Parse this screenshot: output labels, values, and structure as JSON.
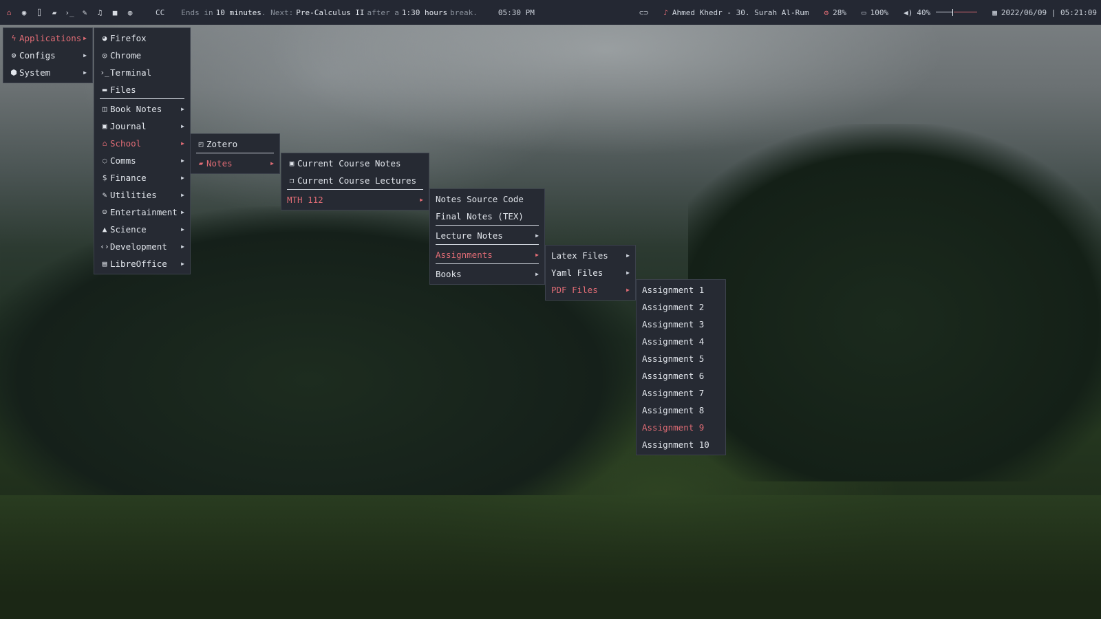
{
  "topbar": {
    "workspace_icons": [
      "home-icon",
      "globe-icon",
      "bank-icon",
      "folder-icon",
      "terminal-icon",
      "edit-icon",
      "music-icon",
      "video-icon",
      "chat-icon"
    ],
    "cc": "CC",
    "ends_in_label": "Ends in",
    "ends_in_value": "10 minutes",
    "next_label": ". Next:",
    "next_course": "Pre-Calculus II",
    "after_label": "after a",
    "break_duration": "1:30 hours",
    "break_label": "break.",
    "class_time": "05:30 PM",
    "now_playing": "Ahmed Khedr - 30. Surah Al-Rum",
    "cpu": "28%",
    "battery": "100%",
    "volume": "40%",
    "volume_level": 0.4,
    "datetime": "2022/06/09 | 05:21:09"
  },
  "menus": {
    "root": [
      {
        "label": "Applications",
        "icon": "bolt-icon",
        "glyph": "ϟ",
        "submenu": true,
        "active": true
      },
      {
        "label": "Configs",
        "icon": "gears-icon",
        "glyph": "⚙",
        "submenu": true
      },
      {
        "label": "System",
        "icon": "cube-icon",
        "glyph": "⬢",
        "submenu": true
      }
    ],
    "applications": [
      {
        "label": "Firefox",
        "icon": "firefox-icon",
        "glyph": "◕"
      },
      {
        "label": "Chrome",
        "icon": "chrome-icon",
        "glyph": "◎"
      },
      {
        "label": "Terminal",
        "icon": "terminal-icon",
        "glyph": "›_"
      },
      {
        "label": "Files",
        "icon": "folder-icon",
        "glyph": "▬",
        "separator_after": true
      },
      {
        "label": "Book Notes",
        "icon": "book-icon",
        "glyph": "◫",
        "submenu": true
      },
      {
        "label": "Journal",
        "icon": "journal-icon",
        "glyph": "▣",
        "submenu": true
      },
      {
        "label": "School",
        "icon": "school-icon",
        "glyph": "⌂",
        "submenu": true,
        "active": true
      },
      {
        "label": "Comms",
        "icon": "comment-icon",
        "glyph": "◌",
        "submenu": true
      },
      {
        "label": "Finance",
        "icon": "dollar-icon",
        "glyph": "$",
        "submenu": true
      },
      {
        "label": "Utilities",
        "icon": "wrench-icon",
        "glyph": "✎",
        "submenu": true
      },
      {
        "label": "Entertainment",
        "icon": "smile-icon",
        "glyph": "☺",
        "submenu": true
      },
      {
        "label": "Science",
        "icon": "flask-icon",
        "glyph": "▲",
        "submenu": true
      },
      {
        "label": "Development",
        "icon": "code-icon",
        "glyph": "‹›",
        "submenu": true
      },
      {
        "label": "LibreOffice",
        "icon": "document-icon",
        "glyph": "▤",
        "submenu": true
      }
    ],
    "school": [
      {
        "label": "Zotero",
        "icon": "zotero-icon",
        "glyph": "◰",
        "separator_after": true
      },
      {
        "label": "Notes",
        "icon": "notes-icon",
        "glyph": "▰",
        "submenu": true,
        "active": true
      }
    ],
    "notes": [
      {
        "label": "Current Course Notes",
        "icon": "image-file-icon",
        "glyph": "▣"
      },
      {
        "label": "Current Course Lectures",
        "icon": "copy-icon",
        "glyph": "❐",
        "separator_after": true
      },
      {
        "label": "MTH 112",
        "submenu": true,
        "active": true
      }
    ],
    "mth112": [
      {
        "label": "Notes Source Code"
      },
      {
        "label": "Final Notes (TEX)",
        "separator_after": true
      },
      {
        "label": "Lecture Notes",
        "submenu": true,
        "separator_after": true
      },
      {
        "label": "Assignments",
        "submenu": true,
        "active": true,
        "separator_after": true
      },
      {
        "label": "Books",
        "submenu": true
      }
    ],
    "assignments": [
      {
        "label": "Latex Files",
        "submenu": true
      },
      {
        "label": "Yaml Files",
        "submenu": true
      },
      {
        "label": "PDF Files",
        "submenu": true,
        "active": true
      }
    ],
    "pdf_files": [
      {
        "label": "Assignment 1"
      },
      {
        "label": "Assignment 2"
      },
      {
        "label": "Assignment 3"
      },
      {
        "label": "Assignment 4"
      },
      {
        "label": "Assignment 5"
      },
      {
        "label": "Assignment 6"
      },
      {
        "label": "Assignment 7"
      },
      {
        "label": "Assignment 8"
      },
      {
        "label": "Assignment 9",
        "active": true
      },
      {
        "label": "Assignment 10"
      }
    ]
  },
  "colors": {
    "accent": "#e06c75",
    "bar_bg": "#242833",
    "menu_bg": "#262a33",
    "text": "#e2e6ec"
  }
}
